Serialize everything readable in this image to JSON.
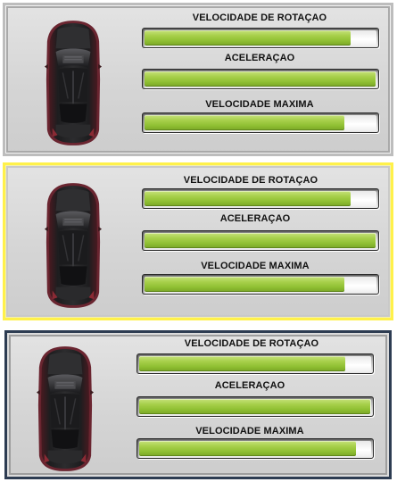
{
  "colors": {
    "bar_fill": "#9acb3c",
    "panel_1_border": "#bdbdbd",
    "panel_2_border": "#fff14a",
    "panel_3_border": "#2d3c52"
  },
  "panels": [
    {
      "state": "default",
      "car_icon": "red-car-top-view-icon",
      "stats": [
        {
          "label": "VELOCIDADE DE ROTAÇAO",
          "value": 0.89
        },
        {
          "label": "ACELERAÇAO",
          "value": 0.995
        },
        {
          "label": "VELOCIDADE MAXIMA",
          "value": 0.86
        }
      ]
    },
    {
      "state": "selected",
      "car_icon": "red-car-top-view-icon",
      "stats": [
        {
          "label": "VELOCIDADE DE ROTAÇAO",
          "value": 0.89
        },
        {
          "label": "ACELERAÇAO",
          "value": 0.995
        },
        {
          "label": "VELOCIDADE MAXIMA",
          "value": 0.86
        }
      ]
    },
    {
      "state": "hover",
      "car_icon": "red-car-top-view-icon",
      "stats": [
        {
          "label": "VELOCIDADE DE ROTAÇAO",
          "value": 0.89
        },
        {
          "label": "ACELERAÇAO",
          "value": 0.995
        },
        {
          "label": "VELOCIDADE MAXIMA",
          "value": 0.935
        }
      ]
    }
  ]
}
